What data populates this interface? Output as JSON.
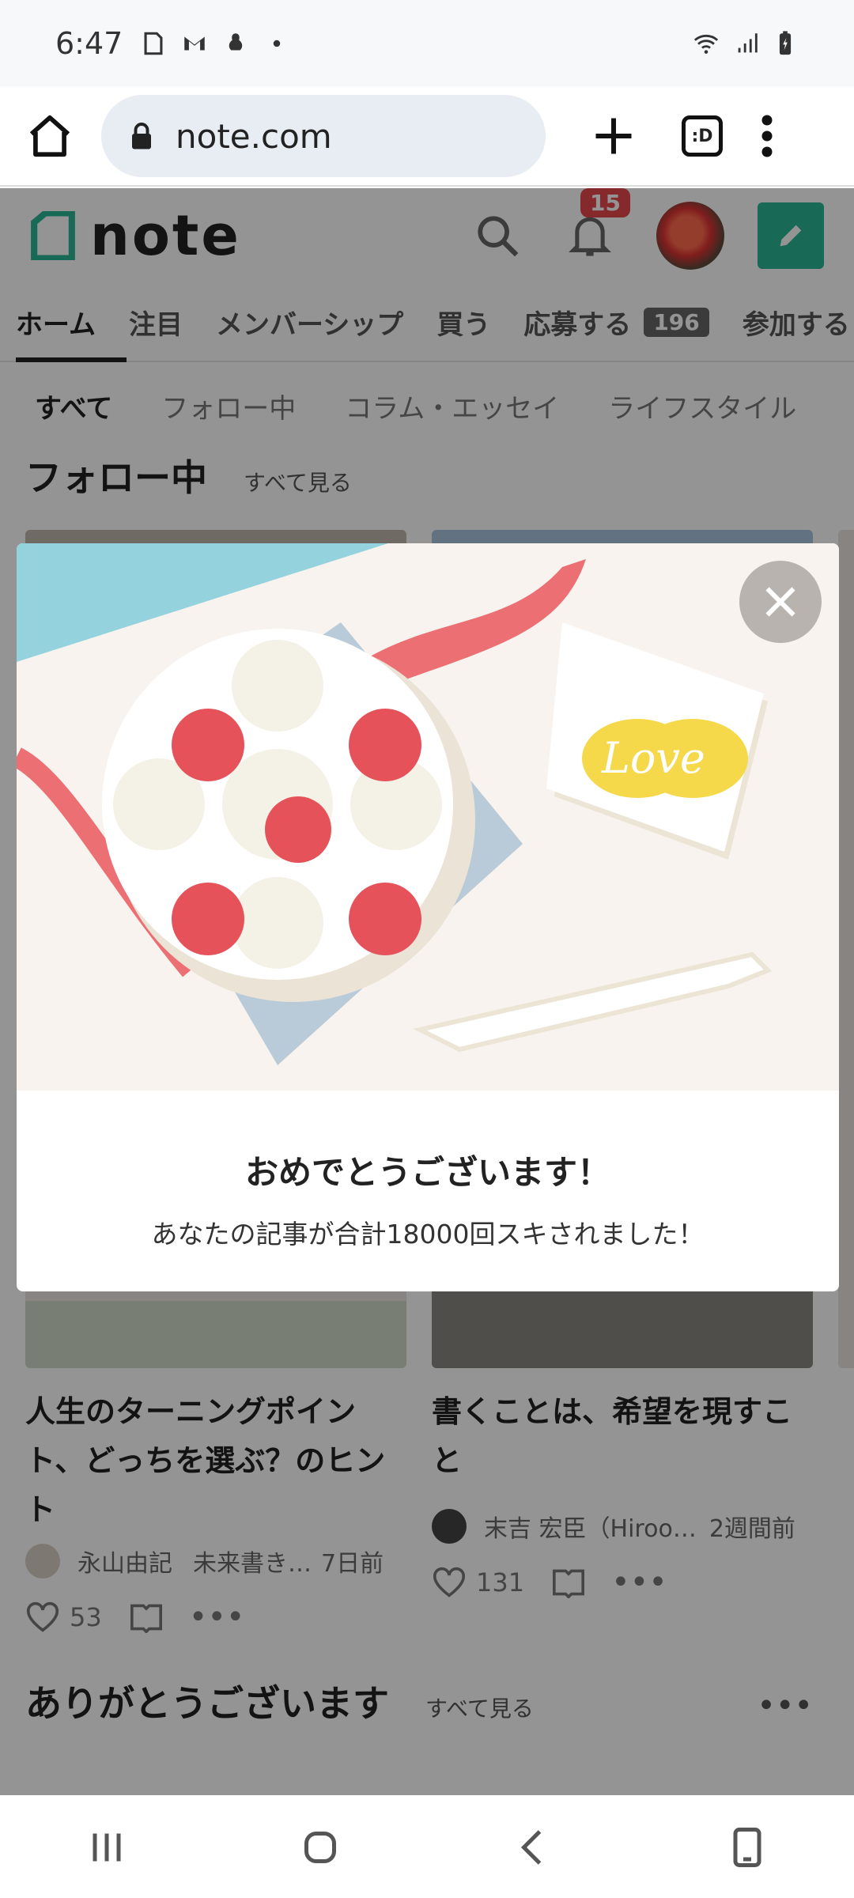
{
  "status_bar": {
    "time": "6:47"
  },
  "browser": {
    "url": "note.com",
    "tabs_label": ":D"
  },
  "note_header": {
    "logo_text": "note",
    "notification_count": "15"
  },
  "main_tabs": [
    {
      "label": "ホーム",
      "active": true
    },
    {
      "label": "注目"
    },
    {
      "label": "メンバーシップ"
    },
    {
      "label": "買う"
    },
    {
      "label": "応募する",
      "count": "196"
    },
    {
      "label": "参加する"
    }
  ],
  "sub_tabs": [
    {
      "label": "すべて",
      "active": true
    },
    {
      "label": "フォロー中"
    },
    {
      "label": "コラム・エッセイ"
    },
    {
      "label": "ライフスタイル"
    }
  ],
  "section_following": {
    "title": "フォロー中",
    "see_all": "すべて見る"
  },
  "cards": [
    {
      "title": "人生のターニングポイント、どっちを選ぶ？のヒント",
      "author": "永山由記",
      "magazine": "未来書き…",
      "time": "7日前",
      "likes": "53"
    },
    {
      "title": "書くことは、希望を現すこと",
      "author": "末吉 宏臣（Hiroo…",
      "time": "2週間前",
      "likes": "131"
    }
  ],
  "section_thanks": {
    "title": "ありがとうございます",
    "see_all": "すべて見る"
  },
  "modal": {
    "title": "おめでとうございます！",
    "message": "あなたの記事が合計18000回スキされました！",
    "card_text": "Love"
  },
  "colors": {
    "brand_green": "#2cb696",
    "badge_red": "#e5484d",
    "overlay": "rgba(0,0,0,0.42)"
  }
}
